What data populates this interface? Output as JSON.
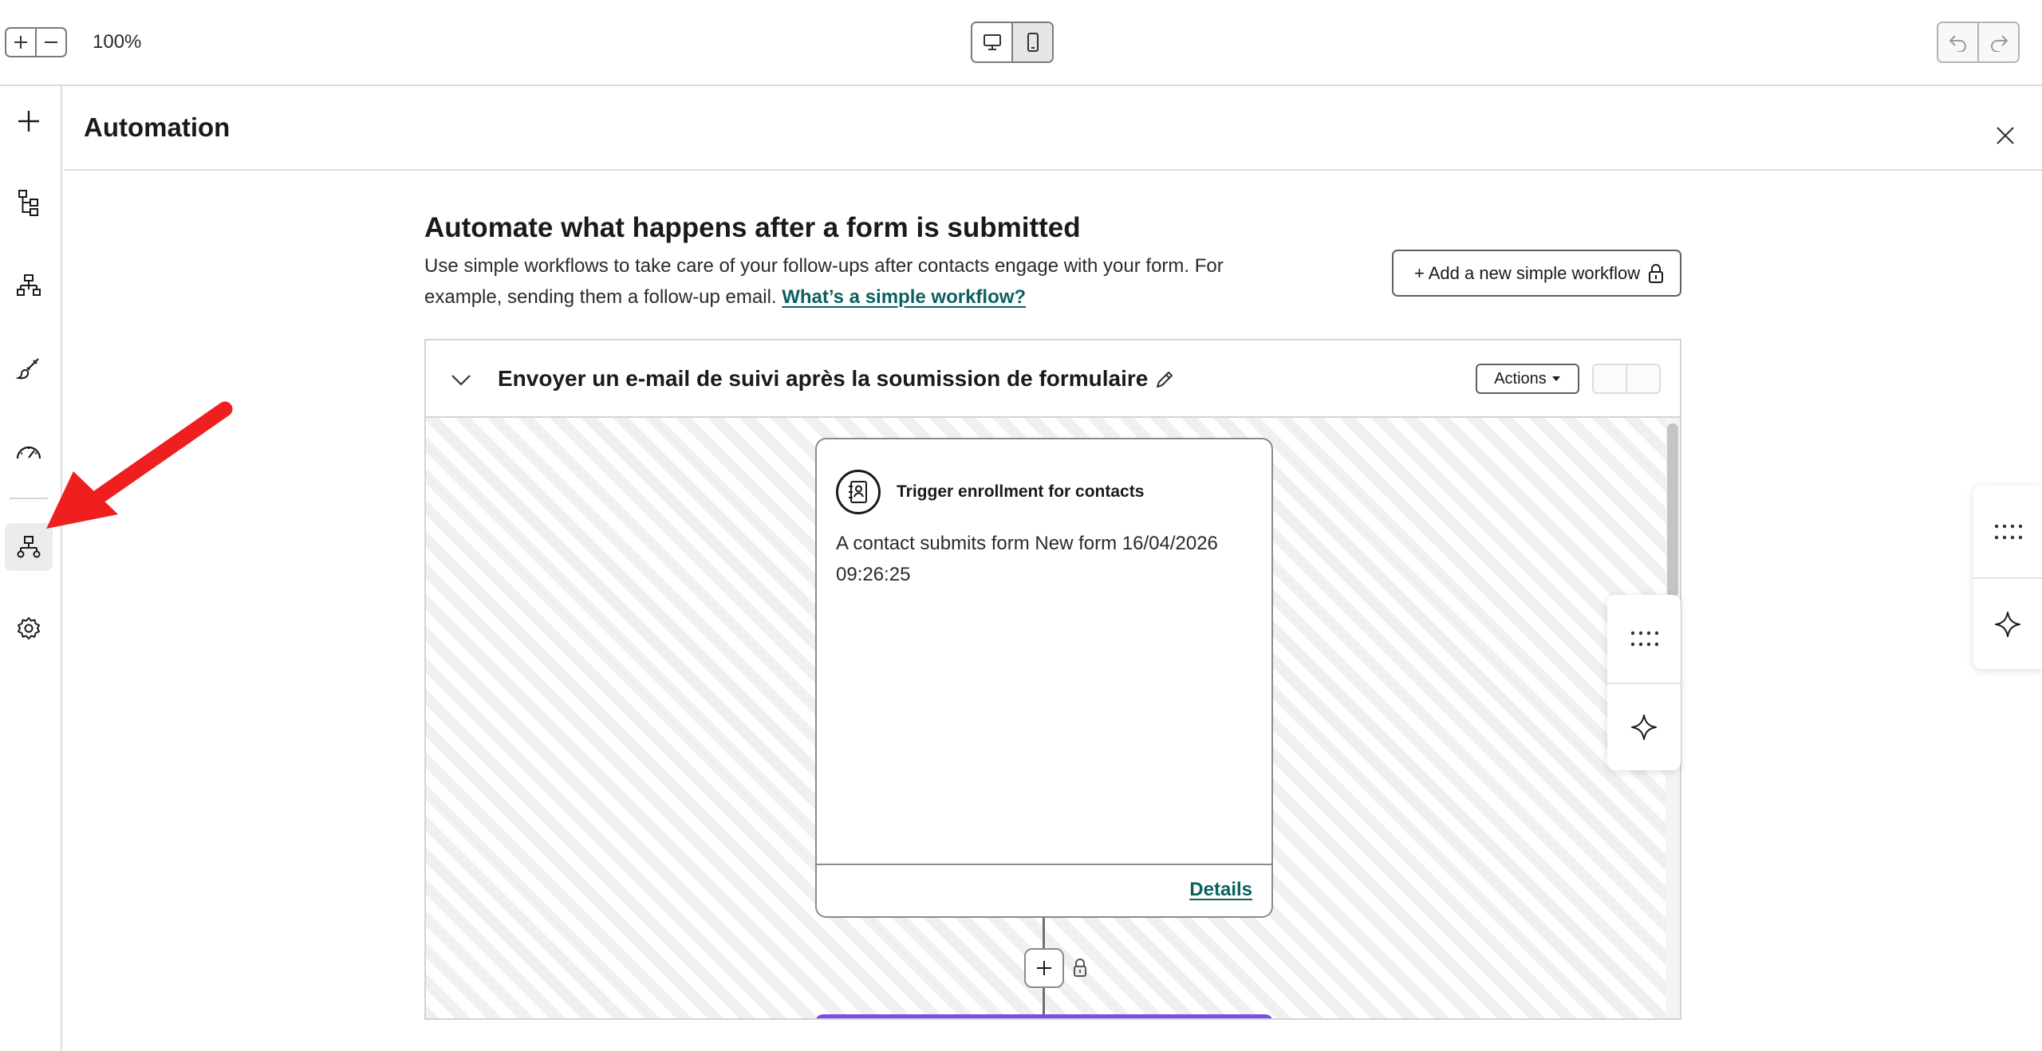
{
  "toolbar": {
    "zoom_level": "100%",
    "zoom_in_icon": "plus-icon",
    "zoom_out_icon": "minus-icon",
    "device_desktop_icon": "desktop-icon",
    "device_mobile_icon": "mobile-icon",
    "active_device": "mobile",
    "undo_icon": "undo-icon",
    "redo_icon": "redo-icon"
  },
  "sidebar": {
    "items": [
      {
        "icon": "plus-icon",
        "active": false
      },
      {
        "icon": "tree-structure-icon",
        "active": false
      },
      {
        "icon": "hierarchy-icon",
        "active": false
      },
      {
        "icon": "paintbrush-icon",
        "active": false
      },
      {
        "icon": "speedometer-icon",
        "active": false
      },
      {
        "icon": "workflow-icon",
        "active": true
      },
      {
        "icon": "gear-icon",
        "active": false
      }
    ]
  },
  "panel": {
    "title": "Automation",
    "close_icon": "close-icon"
  },
  "main": {
    "heading": "Automate what happens after a form is submitted",
    "description": "Use simple workflows to take care of your follow-ups after contacts engage with your form. For example, sending them a follow-up email.",
    "help_link": "What’s a simple workflow?",
    "add_button_label": "+ Add a new simple workflow",
    "add_button_icon": "lock-icon"
  },
  "workflow": {
    "name": "Envoyer un e-mail de suivi après la soumission de formulaire",
    "actions_label": "Actions",
    "trigger": {
      "title": "Trigger enrollment for contacts",
      "description": "A contact submits form New form 16/04/2026 09:26:25",
      "details_link": "Details",
      "icon": "contact-book-icon"
    }
  },
  "floating_tools": {
    "grid_icon": "dots-grid-icon",
    "ai_icon": "sparkle-icon"
  },
  "colors": {
    "link": "#0b6160",
    "annotation_arrow": "#ef1f1f",
    "next_step_accent": "#7b4ee0"
  }
}
